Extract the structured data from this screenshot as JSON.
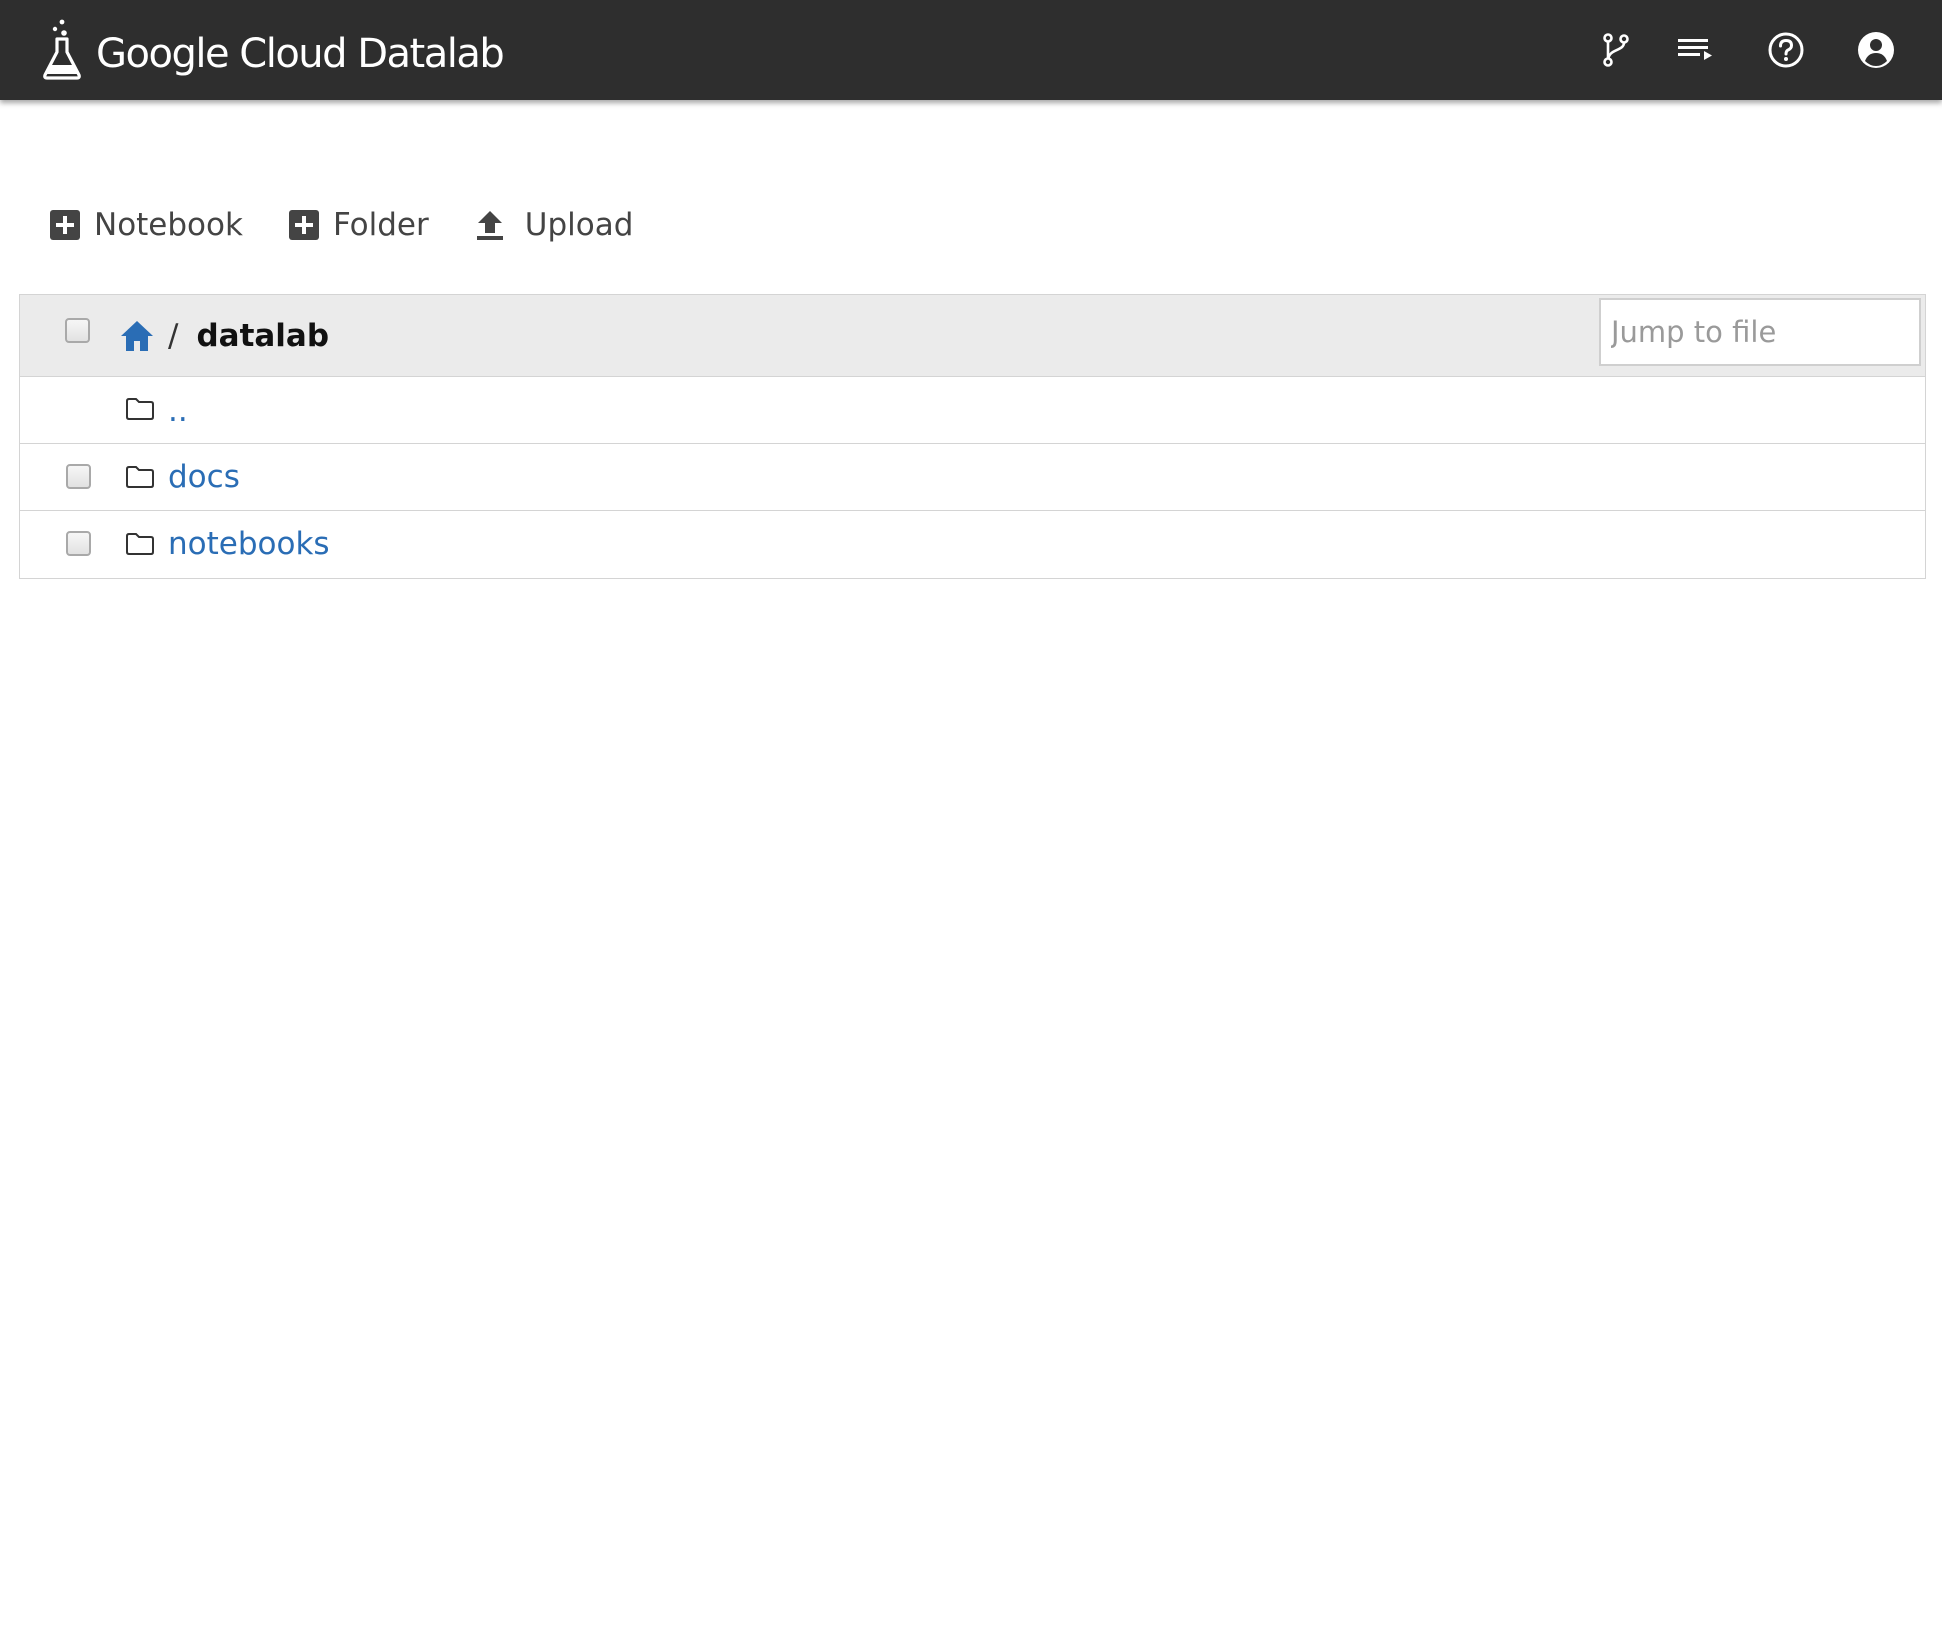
{
  "header": {
    "app_title": "Google Cloud Datalab",
    "icons": [
      "ungit-icon",
      "running-sessions-icon",
      "help-icon",
      "account-icon"
    ]
  },
  "toolbar": {
    "notebook_label": "Notebook",
    "folder_label": "Folder",
    "upload_label": "Upload"
  },
  "filelist": {
    "breadcrumb": {
      "separator": "/",
      "current": "datalab"
    },
    "jump_placeholder": "Jump to file",
    "items": [
      {
        "name": "..",
        "type": "folder",
        "selectable": false
      },
      {
        "name": "docs",
        "type": "folder",
        "selectable": true
      },
      {
        "name": "notebooks",
        "type": "folder",
        "selectable": true
      }
    ]
  },
  "colors": {
    "topbar": "#2e2e2e",
    "link": "#2a6db5",
    "header_row": "#ebebeb",
    "border": "#d4d4d4"
  }
}
